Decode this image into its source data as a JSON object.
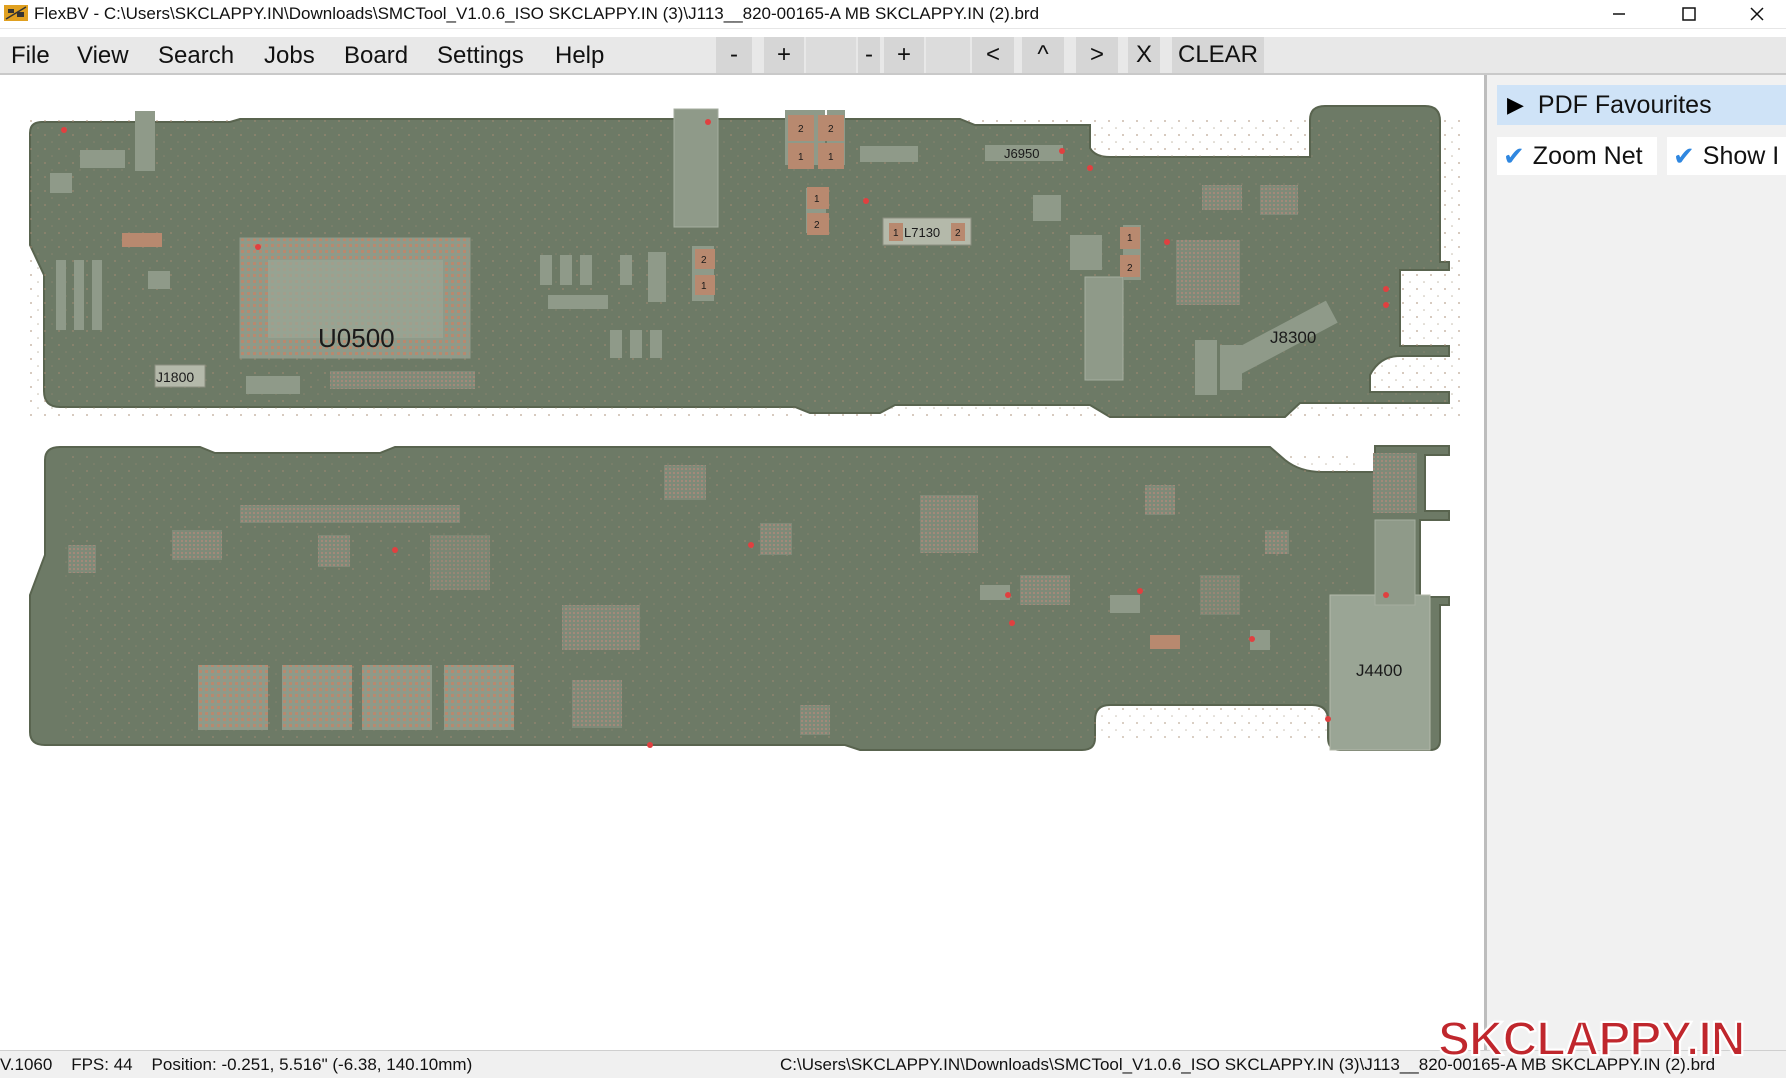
{
  "window": {
    "title": "FlexBV - C:\\Users\\SKCLAPPY.IN\\Downloads\\SMCTool_V1.0.6_ISO SKCLAPPY.IN (3)\\J113__820-00165-A MB SKCLAPPY.IN (2).brd",
    "icon": "flexbv-app-icon",
    "controls": [
      "minimize-icon",
      "maximize-icon",
      "close-icon"
    ]
  },
  "menu": {
    "items": [
      "File",
      "View",
      "Search",
      "Jobs",
      "Board",
      "Settings",
      "Help"
    ]
  },
  "toolbar": {
    "zoom_out_1": "-",
    "zoom_in_1": "+",
    "zoom_out_2": "-",
    "zoom_in_2": "+",
    "prev": "<",
    "up": "^",
    "next": ">",
    "close": "X",
    "clear": "CLEAR"
  },
  "board": {
    "labels": [
      "U0500",
      "J1800",
      "L7130",
      "J6950",
      "J8300",
      "J4400"
    ],
    "pad_numbers": [
      "2",
      "2",
      "1",
      "1",
      "1",
      "2",
      "2",
      "1",
      "1",
      "2",
      "1",
      "2"
    ],
    "colors": {
      "pcb": "#6d7a66",
      "pcb_edge": "#59644f",
      "component": "#8f9a89",
      "pad": "#b8896f",
      "pin_marker": "#e04040"
    }
  },
  "side_panel": {
    "pdf_favourites": "PDF Favourites",
    "zoom_net_label": "Zoom Net",
    "zoom_net_checked": true,
    "show_label": "Show I",
    "show_checked": true
  },
  "status": {
    "left": "V.1060    FPS: 44    Position: -0.251, 5.516\" (-6.38, 140.10mm)",
    "right": "C:\\Users\\SKCLAPPY.IN\\Downloads\\SMCTool_V1.0.6_ISO SKCLAPPY.IN (3)\\J113__820-00165-A MB SKCLAPPY.IN (2).brd"
  },
  "watermark": "SKCLAPPY.IN"
}
